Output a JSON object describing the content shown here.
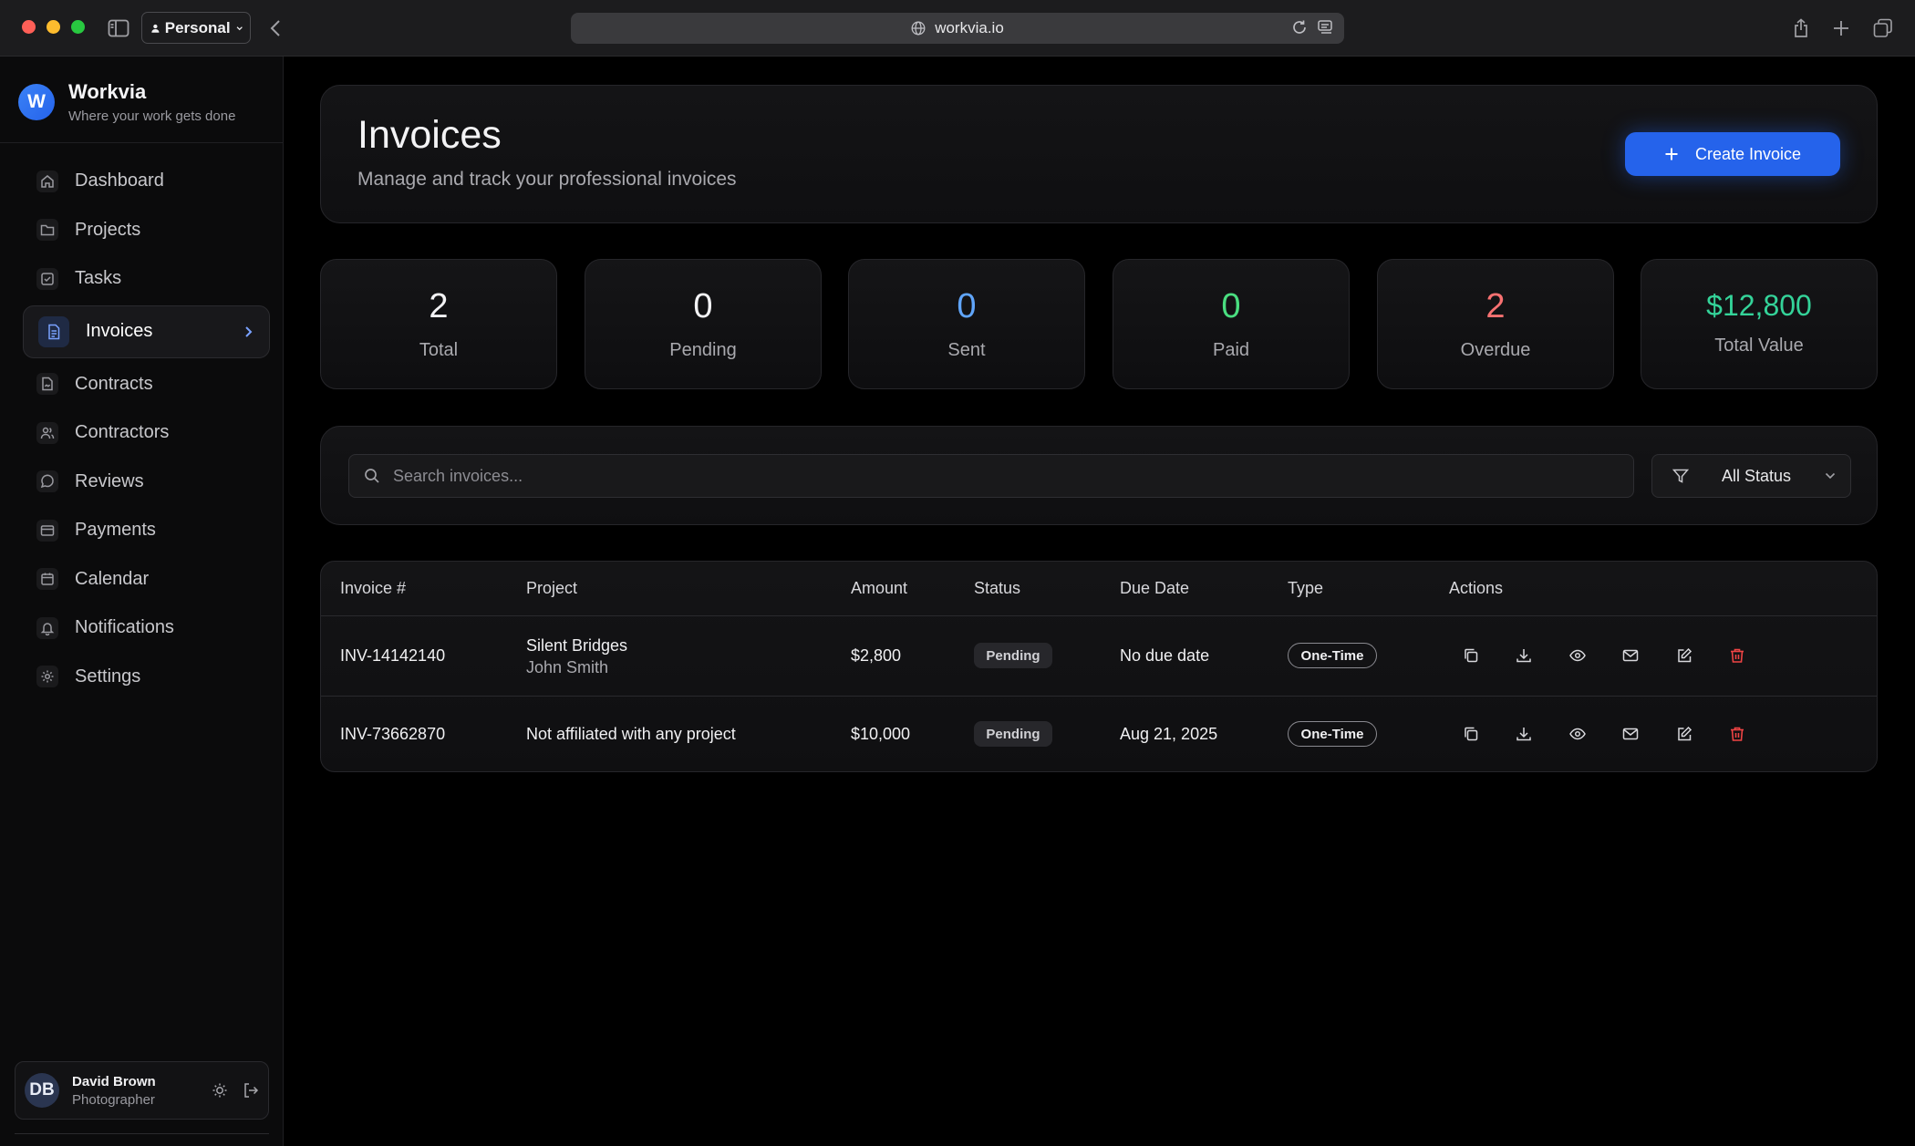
{
  "browser": {
    "profile_label": "Personal",
    "url": "workvia.io"
  },
  "brand": {
    "name": "Workvia",
    "tagline": "Where your work gets done",
    "logo_letter": "W",
    "accent": "#2563eb"
  },
  "sidebar": {
    "items": [
      {
        "label": "Dashboard",
        "icon": "home-icon"
      },
      {
        "label": "Projects",
        "icon": "folder-icon"
      },
      {
        "label": "Tasks",
        "icon": "check-square-icon"
      },
      {
        "label": "Invoices",
        "icon": "file-text-icon",
        "active": true
      },
      {
        "label": "Contracts",
        "icon": "file-signature-icon"
      },
      {
        "label": "Contractors",
        "icon": "users-icon"
      },
      {
        "label": "Reviews",
        "icon": "message-circle-icon"
      },
      {
        "label": "Payments",
        "icon": "credit-card-icon"
      },
      {
        "label": "Calendar",
        "icon": "calendar-icon"
      },
      {
        "label": "Notifications",
        "icon": "bell-icon"
      },
      {
        "label": "Settings",
        "icon": "gear-icon"
      }
    ]
  },
  "user": {
    "initials": "DB",
    "name": "David Brown",
    "role": "Photographer"
  },
  "header": {
    "title": "Invoices",
    "subtitle": "Manage and track your professional invoices",
    "create_label": "Create Invoice"
  },
  "stats": [
    {
      "value": "2",
      "label": "Total",
      "color": "#f3f3f5"
    },
    {
      "value": "0",
      "label": "Pending",
      "color": "#f3f3f5"
    },
    {
      "value": "0",
      "label": "Sent",
      "color": "#60a5fa"
    },
    {
      "value": "0",
      "label": "Paid",
      "color": "#4ade80"
    },
    {
      "value": "2",
      "label": "Overdue",
      "color": "#f87171"
    },
    {
      "value": "$12,800",
      "label": "Total Value",
      "color": "#34d399"
    }
  ],
  "filters": {
    "search_placeholder": "Search invoices...",
    "status_value": "All Status"
  },
  "table": {
    "columns": [
      "Invoice #",
      "Project",
      "Amount",
      "Status",
      "Due Date",
      "Type",
      "Actions"
    ],
    "rows": [
      {
        "invoice": "INV-14142140",
        "project": "Silent Bridges",
        "client": "John Smith",
        "amount": "$2,800",
        "status": "Pending",
        "due": "No due date",
        "type": "One-Time"
      },
      {
        "invoice": "INV-73662870",
        "project": "Not affiliated with any project",
        "client": "",
        "amount": "$10,000",
        "status": "Pending",
        "due": "Aug 21, 2025",
        "type": "One-Time"
      }
    ]
  }
}
